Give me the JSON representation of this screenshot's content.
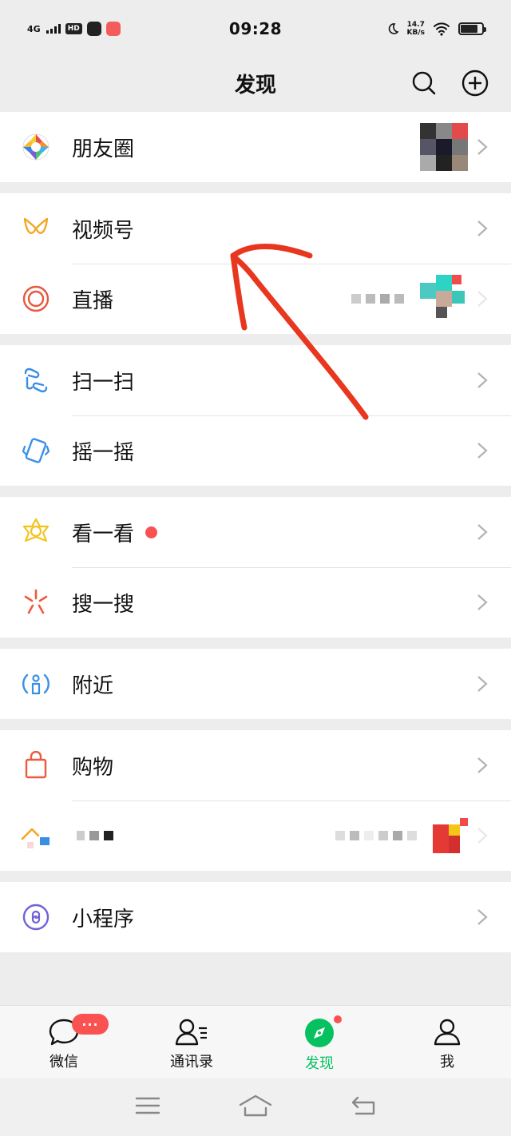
{
  "status_bar": {
    "network": "4G",
    "hd": "HD",
    "time": "09:28",
    "speed_value": "14.7",
    "speed_unit": "KB/s"
  },
  "header": {
    "title": "发现",
    "search_icon": "search-icon",
    "add_icon": "plus-circle-icon"
  },
  "groups": [
    {
      "items": [
        {
          "label": "朋友圈",
          "icon": "moments-icon"
        }
      ]
    },
    {
      "items": [
        {
          "label": "视频号",
          "icon": "channels-icon"
        },
        {
          "label": "直播",
          "icon": "live-icon"
        }
      ]
    },
    {
      "items": [
        {
          "label": "扫一扫",
          "icon": "scan-icon"
        },
        {
          "label": "摇一摇",
          "icon": "shake-icon"
        }
      ]
    },
    {
      "items": [
        {
          "label": "看一看",
          "icon": "top-stories-icon"
        },
        {
          "label": "搜一搜",
          "icon": "search-feature-icon"
        }
      ]
    },
    {
      "items": [
        {
          "label": "附近",
          "icon": "nearby-icon"
        }
      ]
    },
    {
      "items": [
        {
          "label": "购物",
          "icon": "shopping-bag-icon"
        },
        {
          "label": "",
          "icon": "game-icon"
        }
      ]
    },
    {
      "items": [
        {
          "label": "小程序",
          "icon": "mini-programs-icon"
        }
      ]
    }
  ],
  "tabs": [
    {
      "label": "微信",
      "icon": "chat-icon",
      "badge": "···"
    },
    {
      "label": "通讯录",
      "icon": "contacts-icon"
    },
    {
      "label": "发现",
      "icon": "discover-icon",
      "active": true
    },
    {
      "label": "我",
      "icon": "me-icon"
    }
  ],
  "colors": {
    "accent": "#07c160",
    "badge": "#fa5151",
    "annotation_arrow": "#e8361f"
  }
}
